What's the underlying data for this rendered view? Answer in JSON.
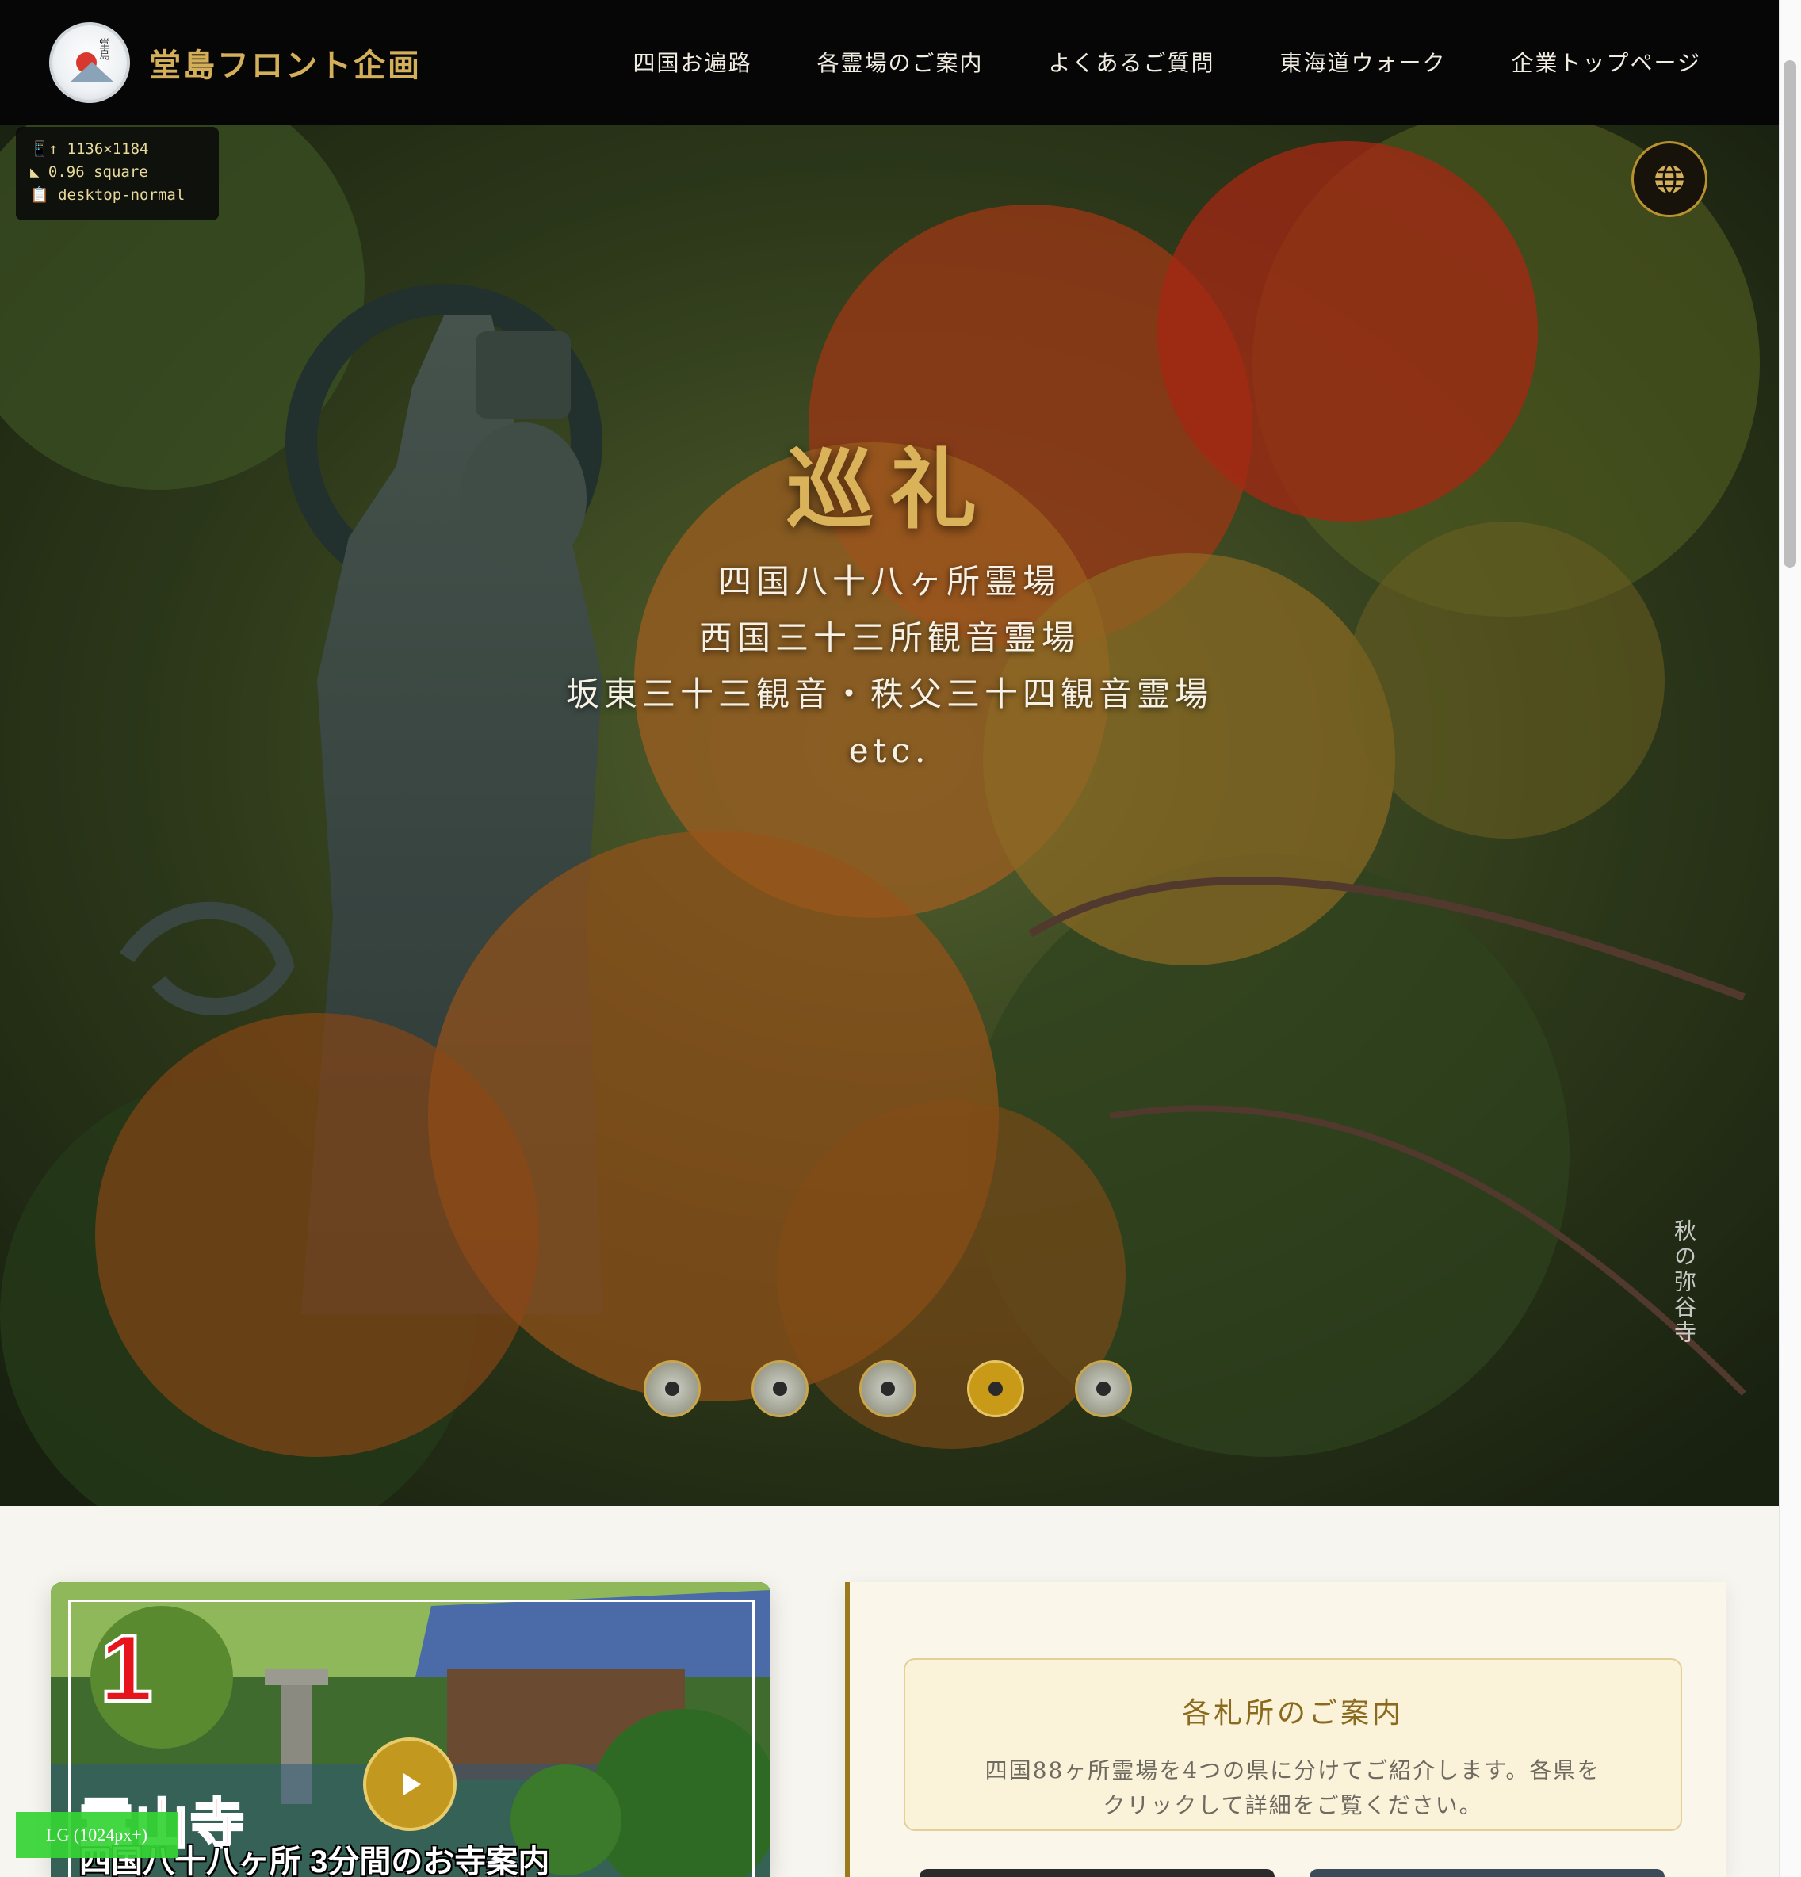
{
  "header": {
    "brand": "堂島フロント企画",
    "nav": [
      "四国お遍路",
      "各霊場のご案内",
      "よくあるご質問",
      "東海道ウォーク",
      "企業トップページ"
    ]
  },
  "hero": {
    "title": "巡礼",
    "lines": [
      "四国八十八ヶ所霊場",
      "西国三十三所観音霊場",
      "坂東三十三観音・秩父三十四観音霊場",
      "etc."
    ],
    "caption": "秋の弥谷寺",
    "slides_total": 5,
    "active_slide": 4
  },
  "debug": {
    "size": "1136×1184",
    "ratio": "0.96 square",
    "mode": "desktop-normal",
    "breakpoint": "LG (1024px+)"
  },
  "video": {
    "number": "1",
    "temple": "霊山寺",
    "subtitle": "四国八十八ヶ所 3分間のお寺案内"
  },
  "info": {
    "title": "各札所のご案内",
    "desc_line1": "四国88ヶ所霊場を4つの県に分けてご紹介します。各県を",
    "desc_line2": "クリックして詳細をご覧ください。"
  },
  "colors": {
    "header_bg": "#060606",
    "gold": "#d4af5a",
    "accent": "#c89a18",
    "panel_border": "#9b7a1e"
  },
  "icons": [
    "globe-icon",
    "play-icon"
  ]
}
